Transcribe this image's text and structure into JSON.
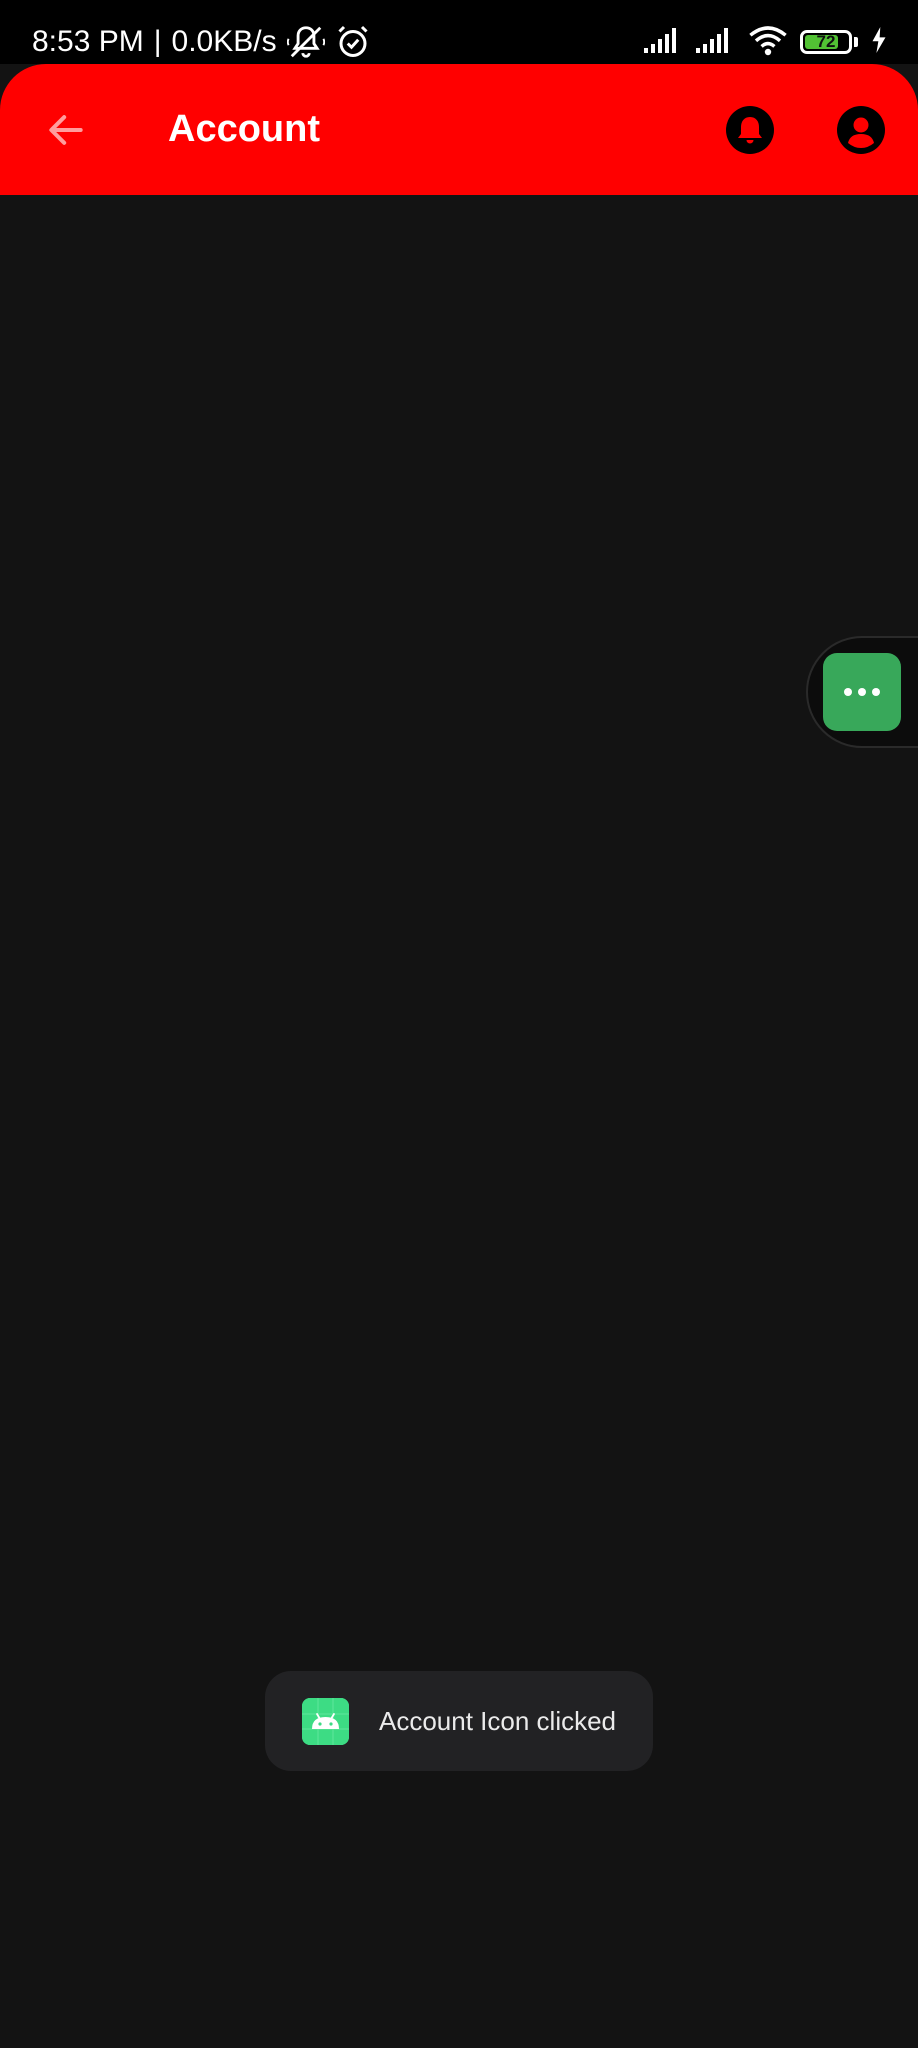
{
  "status_bar": {
    "time": "8:53 PM",
    "separator": "|",
    "net_speed": "0.0KB/s",
    "battery_level": "72",
    "battery_fraction": 0.72,
    "battery_color": "#52c234",
    "icons": [
      "mute-icon",
      "alarm-icon",
      "signal-icon",
      "signal-icon",
      "wifi-icon",
      "battery-icon",
      "charging-icon"
    ]
  },
  "app_bar": {
    "title": "Account",
    "background": "#ff0000",
    "back_icon": "arrow-back-icon",
    "actions": [
      "bell-icon",
      "account-circle-icon"
    ]
  },
  "floating_button": {
    "icon": "more-horizontal-icon",
    "color": "#38a85a"
  },
  "toast": {
    "message": "Account Icon clicked",
    "icon": "android-icon",
    "icon_color": "#3ddc84"
  },
  "theme": {
    "background": "#131313"
  }
}
